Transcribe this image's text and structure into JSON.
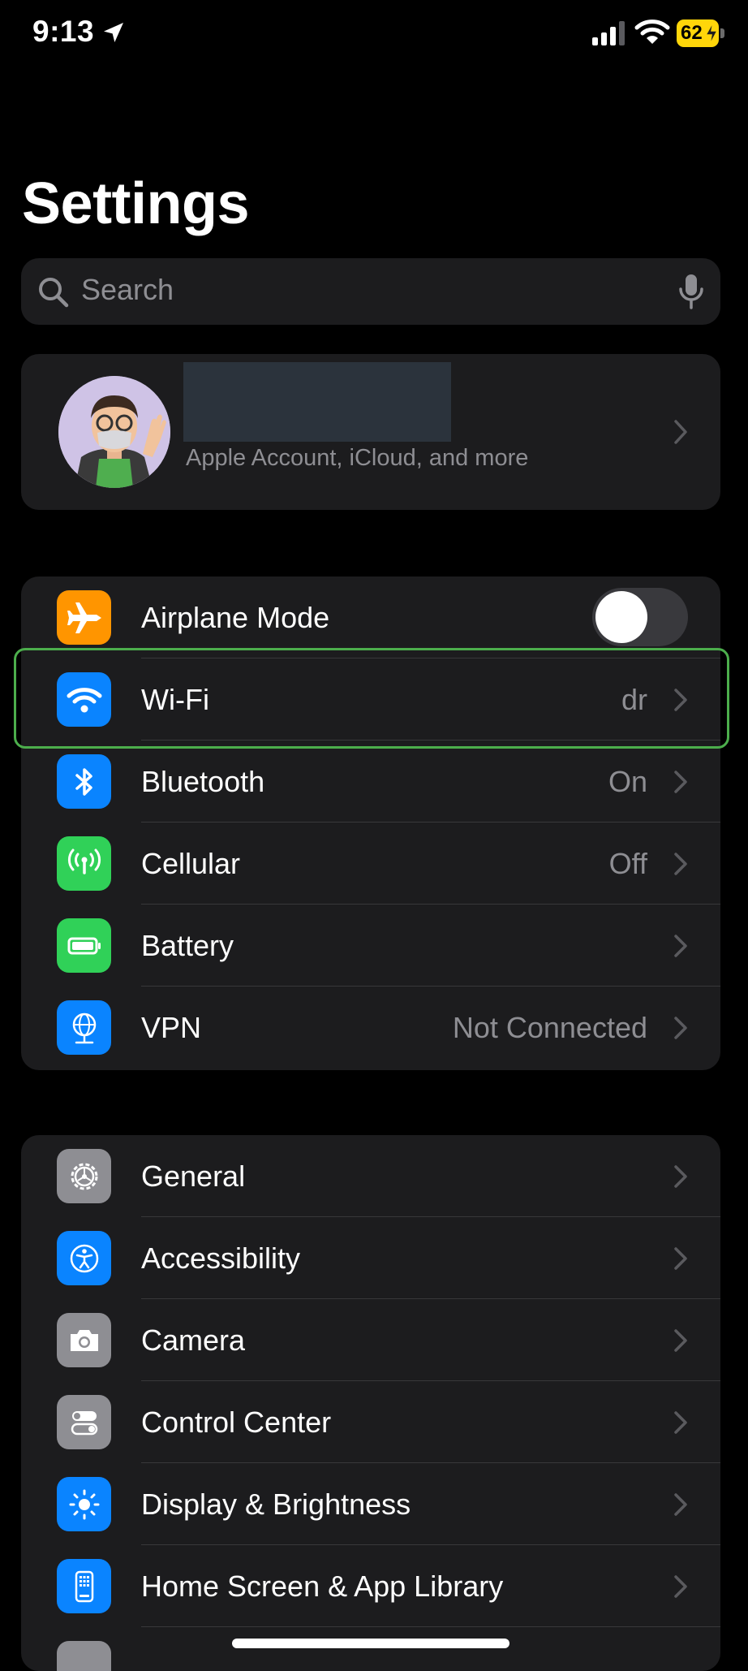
{
  "status_bar": {
    "time": "9:13",
    "battery_percent": "62",
    "signal_bars_filled": 3,
    "signal_bars_total": 4
  },
  "page_title": "Settings",
  "search": {
    "placeholder": "Search"
  },
  "profile": {
    "subtitle": "Apple Account, iCloud, and more"
  },
  "connectivity": {
    "airplane_mode": {
      "label": "Airplane Mode",
      "enabled": false,
      "icon": "airplane-icon",
      "color": "#ff9500"
    },
    "rows": [
      {
        "id": "wifi",
        "label": "Wi-Fi",
        "value": "dr",
        "icon": "wifi-icon",
        "color": "#0a84ff"
      },
      {
        "id": "bluetooth",
        "label": "Bluetooth",
        "value": "On",
        "icon": "bluetooth-icon",
        "color": "#0a84ff"
      },
      {
        "id": "cellular",
        "label": "Cellular",
        "value": "Off",
        "icon": "cellular-icon",
        "color": "#30d158"
      },
      {
        "id": "battery",
        "label": "Battery",
        "value": "",
        "icon": "battery-icon",
        "color": "#30d158"
      },
      {
        "id": "vpn",
        "label": "VPN",
        "value": "Not Connected",
        "icon": "vpn-globe-icon",
        "color": "#0a84ff"
      }
    ]
  },
  "general_group": {
    "rows": [
      {
        "id": "general",
        "label": "General",
        "icon": "gear-icon",
        "color": "#8e8e93"
      },
      {
        "id": "accessibility",
        "label": "Accessibility",
        "icon": "accessibility-icon",
        "color": "#0a84ff"
      },
      {
        "id": "camera",
        "label": "Camera",
        "icon": "camera-icon",
        "color": "#8e8e93"
      },
      {
        "id": "control-center",
        "label": "Control Center",
        "icon": "control-center-icon",
        "color": "#8e8e93"
      },
      {
        "id": "display-brightness",
        "label": "Display & Brightness",
        "icon": "sun-icon",
        "color": "#0a84ff"
      },
      {
        "id": "home-screen",
        "label": "Home Screen & App Library",
        "icon": "home-screen-icon",
        "color": "#0a84ff"
      },
      {
        "id": "partial",
        "label": "",
        "icon": "partial-icon",
        "color": "#8e8e93"
      }
    ]
  },
  "highlight": {
    "target": "wifi",
    "color": "#4cae4c"
  }
}
